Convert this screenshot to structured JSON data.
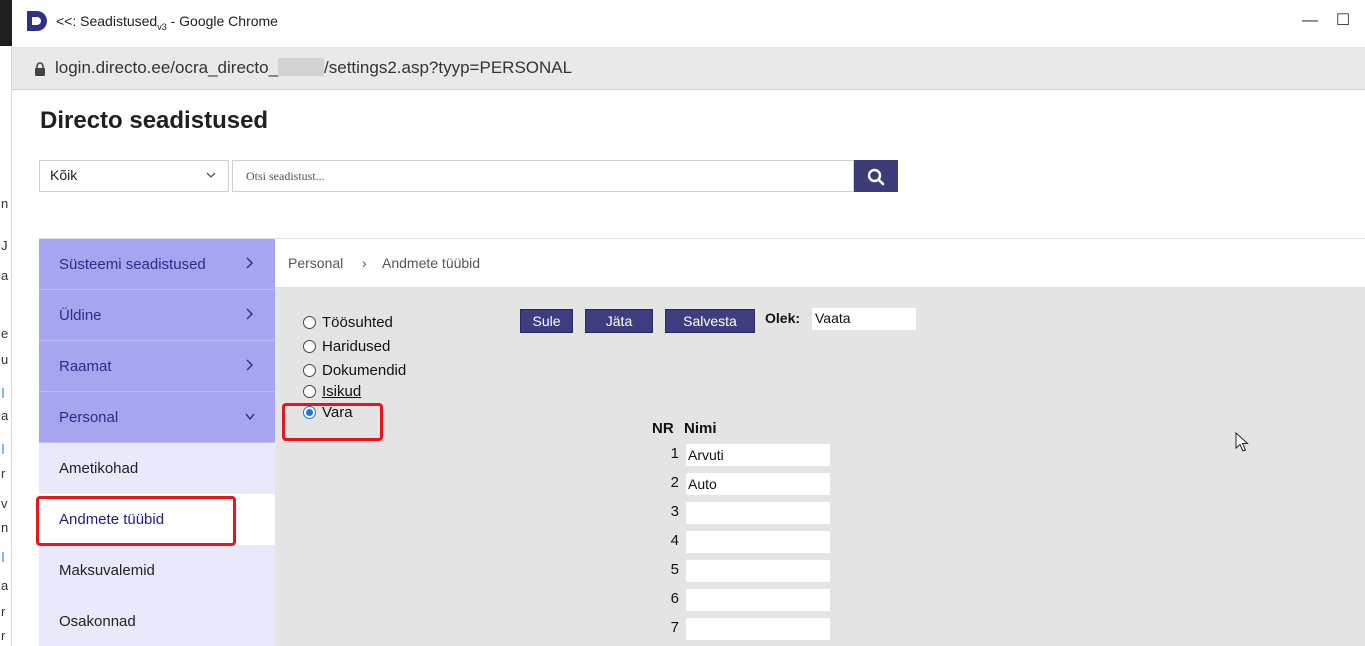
{
  "window": {
    "title_main": "<<: Seadistused",
    "title_sub": "v3",
    "title_suffix": " - Google Chrome",
    "minimize_glyph": "—",
    "maximize_glyph": "☐"
  },
  "address": {
    "url_prefix": "login.directo.ee/ocra_directo_",
    "url_suffix": "/settings2.asp?tyyp=PERSONAL"
  },
  "page": {
    "title": "Directo seadistused"
  },
  "filter": {
    "select_value": "Kõik",
    "search_placeholder": "Otsi seadistust..."
  },
  "sidebar": {
    "items": [
      {
        "label": "Süsteemi seadistused"
      },
      {
        "label": "Üldine"
      },
      {
        "label": "Raamat"
      },
      {
        "label": "Personal"
      }
    ],
    "subitems": [
      {
        "label": "Ametikohad"
      },
      {
        "label": "Andmete tüübid"
      },
      {
        "label": "Maksuvalemid"
      },
      {
        "label": "Osakonnad"
      }
    ]
  },
  "breadcrumb": {
    "parent": "Personal",
    "separator": "›",
    "current": "Andmete tüübid"
  },
  "types": {
    "options": [
      "Töösuhted",
      "Haridused",
      "Dokumendid",
      "Isikud",
      "Vara"
    ],
    "selected": "Vara"
  },
  "toolbar": {
    "close_label": "Sule",
    "next_label": "Jäta",
    "save_label": "Salvesta",
    "status_label": "Olek:",
    "status_value": "Vaata"
  },
  "table": {
    "header_nr": "NR",
    "header_name": "Nimi",
    "rows": [
      {
        "nr": "1",
        "name": "Arvuti"
      },
      {
        "nr": "2",
        "name": "Auto"
      },
      {
        "nr": "3",
        "name": ""
      },
      {
        "nr": "4",
        "name": ""
      },
      {
        "nr": "5",
        "name": ""
      },
      {
        "nr": "6",
        "name": ""
      },
      {
        "nr": "7",
        "name": ""
      }
    ]
  },
  "colors": {
    "accent": "#3d3d80",
    "sidebar": "#a6a6f0",
    "sidebar_sub": "#e9e9fc",
    "highlight": "#e8141b",
    "content_bg": "#e4e4e4"
  }
}
